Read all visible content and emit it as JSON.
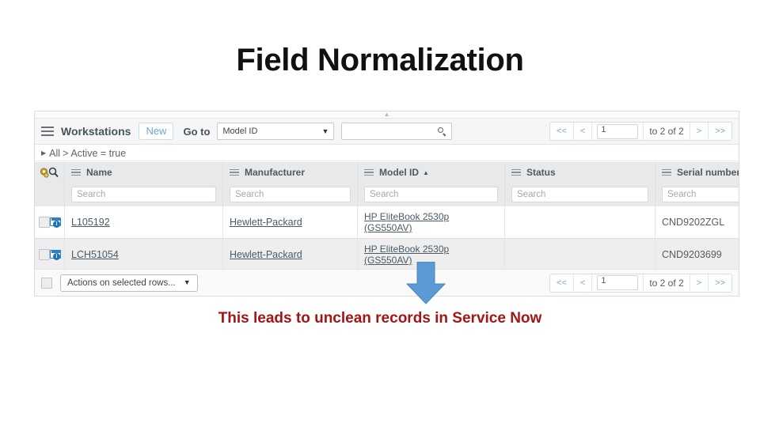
{
  "slide": {
    "title": "Field Normalization",
    "caption": "This leads to unclean records in Service Now"
  },
  "screenshot": {
    "toolbar": {
      "menu_icon": "hamburger-icon",
      "title": "Workstations",
      "new_button": "New",
      "goto_label": "Go to",
      "goto_select_value": "Model ID",
      "search_value": "",
      "search_icon": "search-icon",
      "pager": {
        "first": "<<",
        "prev": "<",
        "page": "1",
        "range": "to 2 of 2",
        "next": ">",
        "last": ">>"
      }
    },
    "breadcrumb": {
      "expand_icon": "triangle-right-icon",
      "root": "All",
      "separator": ">",
      "condition": "Active = true"
    },
    "table": {
      "personalize_icon": "gear-search-icon",
      "columns": [
        {
          "label": "Name",
          "sorted": ""
        },
        {
          "label": "Manufacturer",
          "sorted": ""
        },
        {
          "label": "Model ID",
          "sorted": "▲"
        },
        {
          "label": "Status",
          "sorted": ""
        },
        {
          "label": "Serial number",
          "sorted": ""
        }
      ],
      "search_placeholder": "Search",
      "rows": [
        {
          "name": "L105192",
          "manufacturer": "Hewlett-Packard",
          "model_id_line1": "HP EliteBook 2530p",
          "model_id_line2": "(GS550AV)",
          "status": "",
          "serial_number": "CND9202ZGL"
        },
        {
          "name": "LCH51054",
          "manufacturer": "Hewlett-Packard",
          "model_id_line1": "HP EliteBook 2530p",
          "model_id_line2": "(GS550AV)",
          "status": "",
          "serial_number": "CND9203699"
        }
      ]
    },
    "footer": {
      "actions_label": "Actions on selected rows...",
      "pager": {
        "first": "<<",
        "prev": "<",
        "page": "1",
        "range": "to 2 of 2",
        "next": ">",
        "last": ">>"
      }
    }
  },
  "annotation": {
    "arrow_icon": "down-arrow-icon",
    "arrow_color": "#5b9bd5"
  }
}
